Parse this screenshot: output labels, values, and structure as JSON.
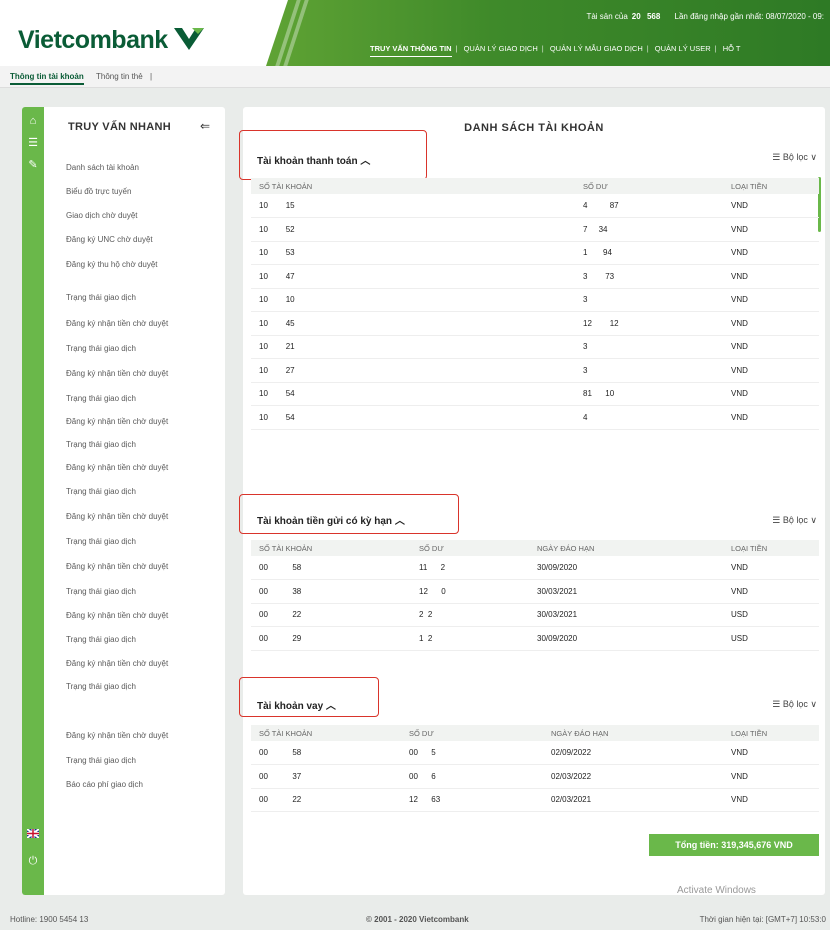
{
  "header": {
    "logo": "Vietcombank",
    "info_label_1": "Tài sản của",
    "info_value_1": "20",
    "info_label_2": "568",
    "info_label_3": "Lần đăng nhập gần nhất: 08/07/2020 - 09:",
    "nav": [
      "TRUY VẤN THÔNG TIN",
      "QUẢN LÝ GIAO DỊCH",
      "QUẢN LÝ MẪU GIAO DỊCH",
      "QUẢN LÝ USER",
      "HỖ T"
    ]
  },
  "subtabs": [
    "Thông tin tài khoản",
    "Thông tin thẻ"
  ],
  "quick": {
    "title": "TRUY VẤN NHANH",
    "back": "⇐",
    "items": [
      "Danh sách tài khoản",
      "Biểu đồ trực tuyến",
      "Giao dịch chờ duyệt",
      "Đăng ký UNC chờ duyệt",
      "Đăng ký thu hộ chờ duyệt",
      "Trạng thái giao dịch",
      "Đăng ký nhận tiền chờ duyệt",
      "Trạng thái giao dịch",
      "Đăng ký nhận tiền chờ duyệt",
      "Trạng thái giao dịch",
      "Đăng ký nhận tiền chờ duyệt",
      "Trạng thái giao dịch",
      "Đăng ký nhận tiền chờ duyệt",
      "Trạng thái giao dịch",
      "Đăng ký nhận tiền chờ duyệt",
      "Trạng thái giao dịch",
      "Đăng ký nhận tiền chờ duyệt",
      "Trạng thái giao dịch",
      "Đăng ký nhận tiền chờ duyệt",
      "Trạng thái giao dịch",
      "Đăng ký nhận tiền chờ duyệt",
      "Trạng thái giao dịch",
      "Báo cáo phí giao dịch"
    ]
  },
  "main": {
    "title": "DANH SÁCH TÀI KHOẢN",
    "filter_label": "Bộ lọc",
    "payment": {
      "title": "Tài khoản thanh toán",
      "headers": [
        "SỐ TÀI KHOẢN",
        "SỐ DƯ",
        "LOẠI TIỀN"
      ],
      "rows": [
        [
          "10",
          "15",
          "4",
          "87",
          "VND"
        ],
        [
          "10",
          "52",
          "7",
          "34",
          "VND"
        ],
        [
          "10",
          "53",
          "1",
          "94",
          "VND"
        ],
        [
          "10",
          "47",
          "3",
          "73",
          "VND"
        ],
        [
          "10",
          "10",
          "3",
          "",
          "VND"
        ],
        [
          "10",
          "45",
          "12",
          "12",
          "VND"
        ],
        [
          "10",
          "21",
          "3",
          "",
          "VND"
        ],
        [
          "10",
          "27",
          "3",
          "",
          "VND"
        ],
        [
          "10",
          "54",
          "81",
          "10",
          "VND"
        ],
        [
          "10",
          "54",
          "4",
          "",
          "VND"
        ]
      ]
    },
    "deposit": {
      "title": "Tài khoản tiền gửi có kỳ hạn",
      "headers": [
        "SỐ TÀI KHOẢN",
        "SỐ DƯ",
        "NGÀY ĐÁO HẠN",
        "LOẠI TIỀN"
      ],
      "rows": [
        [
          "00",
          "58",
          "11",
          "2",
          "30/09/2020",
          "VND"
        ],
        [
          "00",
          "38",
          "12",
          "0",
          "30/03/2021",
          "VND"
        ],
        [
          "00",
          "22",
          "2",
          "2",
          "30/03/2021",
          "USD"
        ],
        [
          "00",
          "29",
          "1",
          "2",
          "30/09/2020",
          "USD"
        ]
      ]
    },
    "loan": {
      "title": "Tài khoản vay",
      "headers": [
        "SỐ TÀI KHOẢN",
        "SỐ DƯ",
        "NGÀY ĐÁO HẠN",
        "LOẠI TIỀN"
      ],
      "rows": [
        [
          "00",
          "58",
          "00",
          "5",
          "02/09/2022",
          "VND"
        ],
        [
          "00",
          "37",
          "00",
          "6",
          "02/03/2022",
          "VND"
        ],
        [
          "00",
          "22",
          "12",
          "63",
          "02/03/2021",
          "VND"
        ]
      ],
      "total": "Tổng tiền: 319,345,676 VND"
    }
  },
  "watermark": "Activate Windows",
  "footer": {
    "hotline": "Hotline: 1900 5454 13",
    "copyright": "© 2001 - 2020 Vietcombank",
    "time": "Thời gian hiện tại: [GMT+7] 10:53:0"
  }
}
